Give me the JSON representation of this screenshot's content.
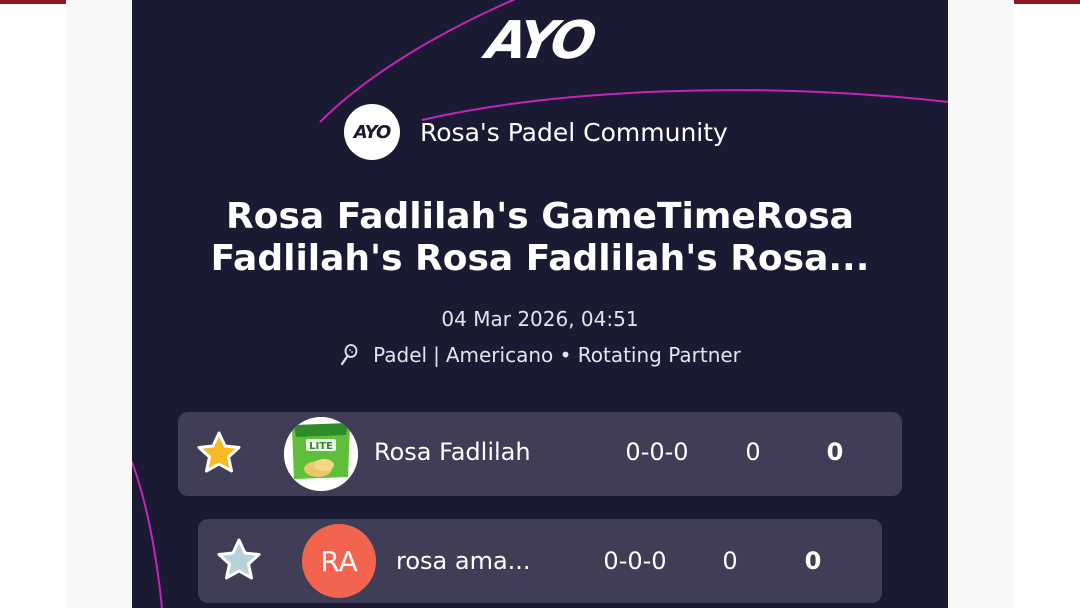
{
  "brand": {
    "logo_text": "AYO",
    "accent_color": "#c424b8"
  },
  "community": {
    "avatar_text": "AYO",
    "name": "Rosa's Padel Community"
  },
  "game": {
    "title": "Rosa Fadlilah's GameTimeRosa Fadlilah's Rosa Fadlilah's Rosa...",
    "datetime": "04 Mar 2026, 04:51",
    "sport": "Padel",
    "format": "Americano • Rotating Partner",
    "sport_icon": "racket-icon"
  },
  "players": [
    {
      "rank_icon": "gold-star-icon",
      "avatar": "photo",
      "avatar_label": "LITE",
      "name": "Rosa Fadlilah",
      "record": "0-0-0",
      "games": "0",
      "points": "0"
    },
    {
      "rank_icon": "silver-star-icon",
      "avatar": "initials",
      "avatar_initials": "RA",
      "avatar_color": "#f2644e",
      "name": "rosa ama...",
      "record": "0-0-0",
      "games": "0",
      "points": "0"
    }
  ]
}
